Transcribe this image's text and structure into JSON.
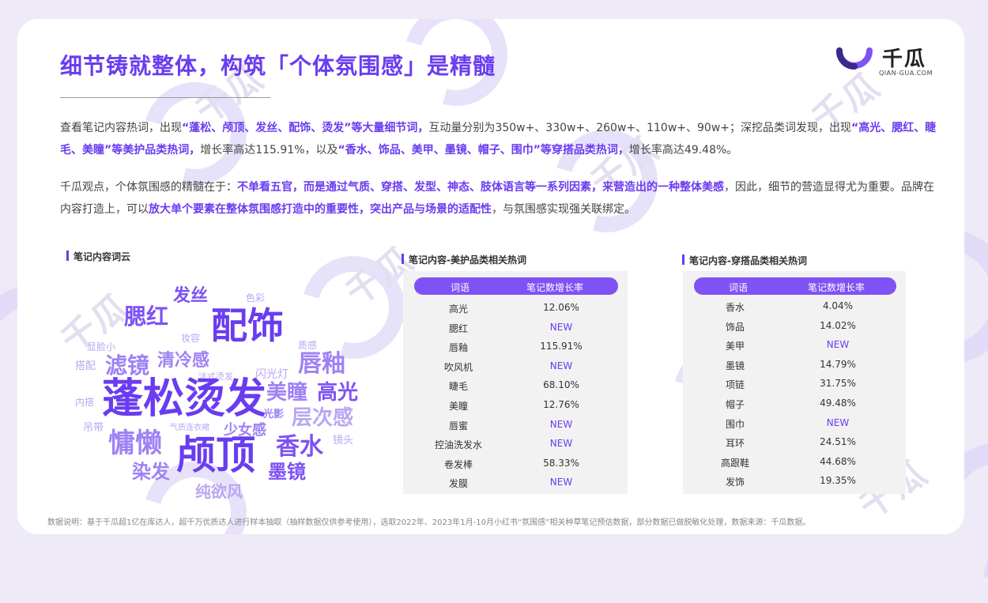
{
  "title": "细节铸就整体，构筑「个体氛围感」是精髓",
  "logo": {
    "name": "千瓜",
    "url": "QIAN-GUA.COM"
  },
  "watermark": "千瓜",
  "para1": {
    "t1": "查看笔记内容热词，出现",
    "h1": "“蓬松、颅顶、发丝、配饰、烫发”等大量细节词，",
    "t2": "互动量分别为350w+、330w+、260w+、110w+、90w+；深挖品类词发现，出现",
    "h2": "“高光、腮红、睫毛、美瞳”等美护品类热词，",
    "t3": "增长率高达115.91%，以及",
    "h3": "“香水、饰品、美甲、墨镜、帽子、围巾”等穿搭品类热词，",
    "t4": "增长率高达49.48%。"
  },
  "para2": {
    "t1": "千瓜观点，个体氛围感的精髓在于：",
    "h1": "不单看五官，而是通过气质、穿搭、发型、神态、肢体语言等一系列因素，来营造出的一种整体美感",
    "t2": "，因此，细节的营造显得尤为重要。品牌在内容打造上，可以",
    "h2": "放大单个要素在整体氛围感打造中的重要性，突出产品与场景的适配性",
    "t3": "，与氛围感实现强关联绑定。"
  },
  "cloud": {
    "title": "笔记内容词云",
    "words": [
      "发丝",
      "色彩",
      "腮红",
      "配饰",
      "妆容",
      "显脸小",
      "质感",
      "滤镜",
      "清冷感",
      "唇釉",
      "搭配",
      "法式烫发",
      "闪光灯",
      "蓬松烫发",
      "美瞳",
      "高光",
      "内搭",
      "光影",
      "层次感",
      "吊带",
      "气质连衣裙",
      "少女感",
      "慵懒",
      "颅顶",
      "香水",
      "镜头",
      "染发",
      "墨镜",
      "纯欲风"
    ]
  },
  "table1": {
    "title": "笔记内容-美护品类相关热词",
    "headers": [
      "词语",
      "笔记数增长率"
    ],
    "rows": [
      [
        "高光",
        "12.06%"
      ],
      [
        "腮红",
        "NEW"
      ],
      [
        "唇釉",
        "115.91%"
      ],
      [
        "吹风机",
        "NEW"
      ],
      [
        "睫毛",
        "68.10%"
      ],
      [
        "美瞳",
        "12.76%"
      ],
      [
        "唇蜜",
        "NEW"
      ],
      [
        "控油洗发水",
        "NEW"
      ],
      [
        "卷发棒",
        "58.33%"
      ],
      [
        "发膜",
        "NEW"
      ]
    ]
  },
  "table2": {
    "title": "笔记内容-穿搭品类相关热词",
    "headers": [
      "词语",
      "笔记数增长率"
    ],
    "rows": [
      [
        "香水",
        "4.04%"
      ],
      [
        "饰品",
        "14.02%"
      ],
      [
        "美甲",
        "NEW"
      ],
      [
        "墨镜",
        "14.79%"
      ],
      [
        "项链",
        "31.75%"
      ],
      [
        "帽子",
        "49.48%"
      ],
      [
        "围巾",
        "NEW"
      ],
      [
        "耳环",
        "24.51%"
      ],
      [
        "高跟鞋",
        "44.68%"
      ],
      [
        "发饰",
        "19.35%"
      ]
    ]
  },
  "footnote": "数据说明：基于千瓜超1亿在库达人，超千万优质达人进行样本抽取（抽样数据仅供参考使用），选取2022年、2023年1月-10月小红书“氛围感”相关种草笔记预估数据，部分数据已做脱敏化处理，数据来源：千瓜数据。",
  "colors": {
    "accent": "#6a3cf0",
    "header": "#7e52f4",
    "new": "#6a3cf0"
  }
}
